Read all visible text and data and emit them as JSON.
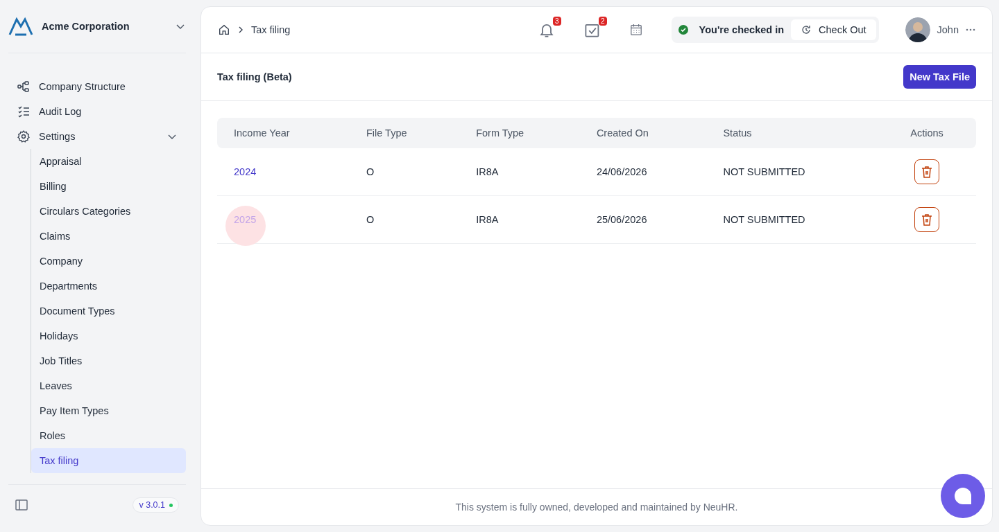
{
  "org": {
    "name": "Acme Corporation"
  },
  "nav": [
    {
      "label": "Company Structure"
    },
    {
      "label": "Audit Log"
    },
    {
      "label": "Settings",
      "expanded": true,
      "children": [
        {
          "label": "Appraisal",
          "selected": false
        },
        {
          "label": "Billing",
          "selected": false
        },
        {
          "label": "Circulars Categories",
          "selected": false
        },
        {
          "label": "Claims",
          "selected": false
        },
        {
          "label": "Company",
          "selected": false
        },
        {
          "label": "Departments",
          "selected": false
        },
        {
          "label": "Document Types",
          "selected": false
        },
        {
          "label": "Holidays",
          "selected": false
        },
        {
          "label": "Job Titles",
          "selected": false
        },
        {
          "label": "Leaves",
          "selected": false
        },
        {
          "label": "Pay Item Types",
          "selected": false
        },
        {
          "label": "Roles",
          "selected": false
        },
        {
          "label": "Tax filing",
          "selected": true
        }
      ]
    }
  ],
  "version": "v 3.0.1",
  "breadcrumb": [
    "Tax filing"
  ],
  "header": {
    "notifications": "3",
    "tasks": "2",
    "checkin_status": "You're checked in",
    "checkout_button": "Check Out",
    "user": "John"
  },
  "page": {
    "title": "Tax filing (Beta)",
    "new_button": "New Tax File"
  },
  "table": {
    "columns": [
      "Income Year",
      "File Type",
      "Form Type",
      "Created On",
      "Status",
      "Actions"
    ],
    "rows": [
      {
        "year": "2024",
        "file_type": "O",
        "form_type": "IR8A",
        "created_on": "24/06/2026",
        "status": "NOT SUBMITTED",
        "hovered": false
      },
      {
        "year": "2025",
        "file_type": "O",
        "form_type": "IR8A",
        "created_on": "25/06/2026",
        "status": "NOT SUBMITTED",
        "hovered": true
      }
    ]
  },
  "footer": "This system is fully owned, developed and maintained by NeuHR."
}
